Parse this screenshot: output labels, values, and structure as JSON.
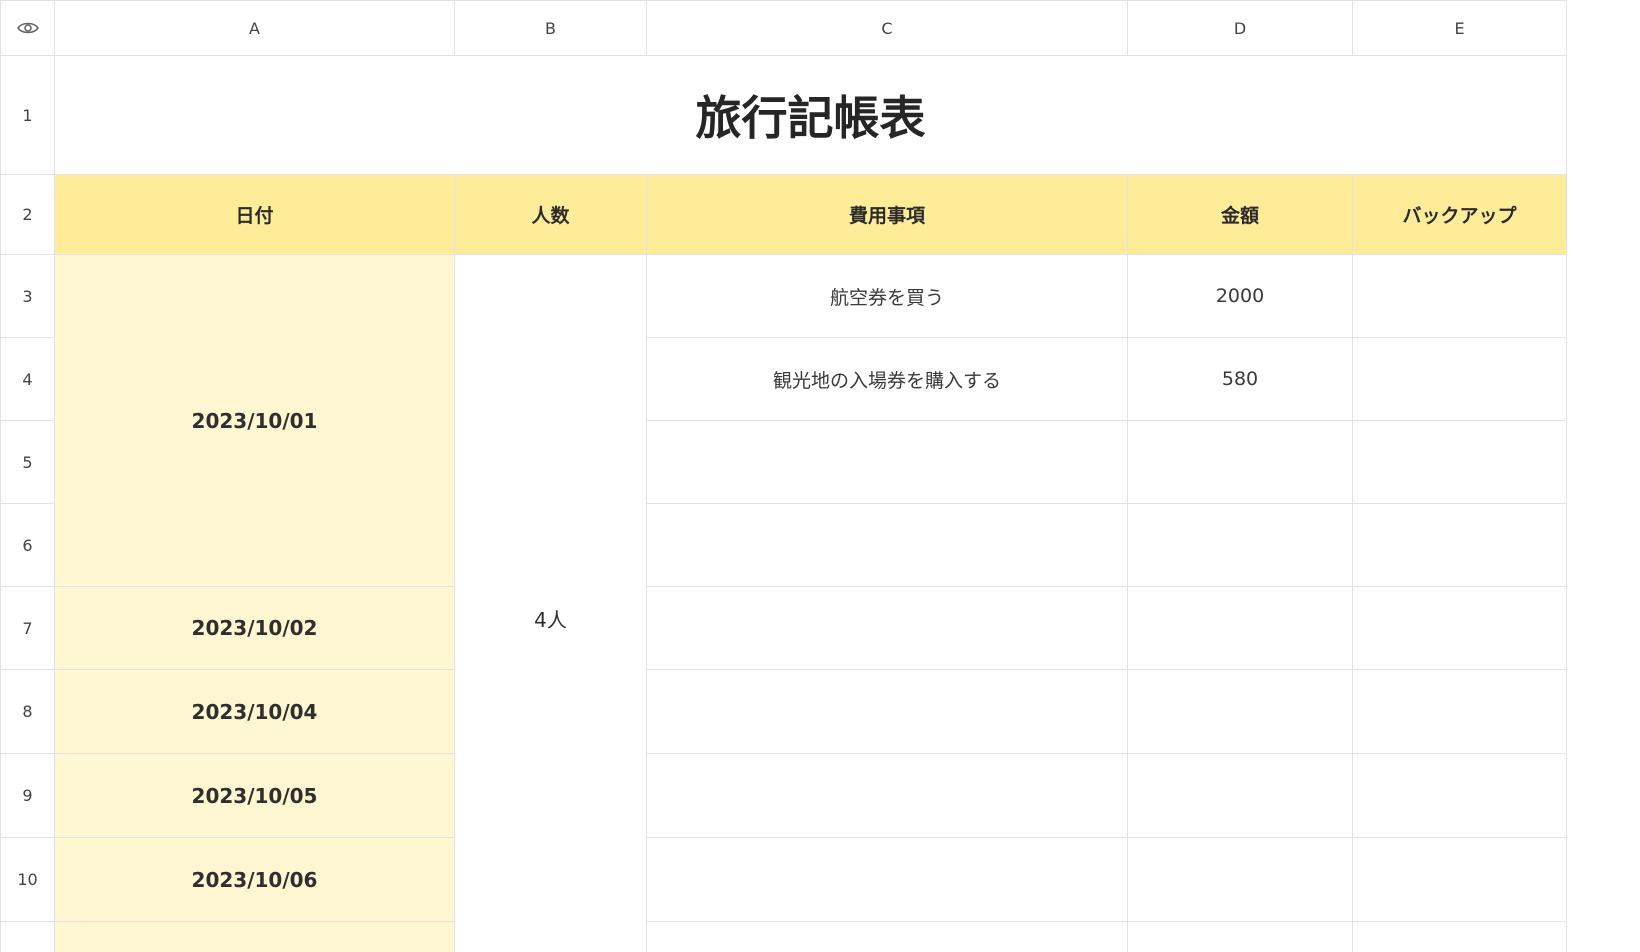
{
  "columns": [
    "A",
    "B",
    "C",
    "D",
    "E"
  ],
  "rows": [
    "1",
    "2",
    "3",
    "4",
    "5",
    "6",
    "7",
    "8",
    "9",
    "10"
  ],
  "title": "旅行記帳表",
  "headers": {
    "date": "日付",
    "people": "人数",
    "item": "費用事項",
    "amount": "金額",
    "backup": "バックアップ"
  },
  "dates": [
    "2023/10/01",
    "2023/10/02",
    "2023/10/04",
    "2023/10/05",
    "2023/10/06"
  ],
  "people_count": "4人",
  "items": [
    {
      "item": "航空券を買う",
      "amount": "2000"
    },
    {
      "item": "観光地の入場券を購入する",
      "amount": "580"
    }
  ],
  "icons": {
    "corner": "eye-icon"
  }
}
